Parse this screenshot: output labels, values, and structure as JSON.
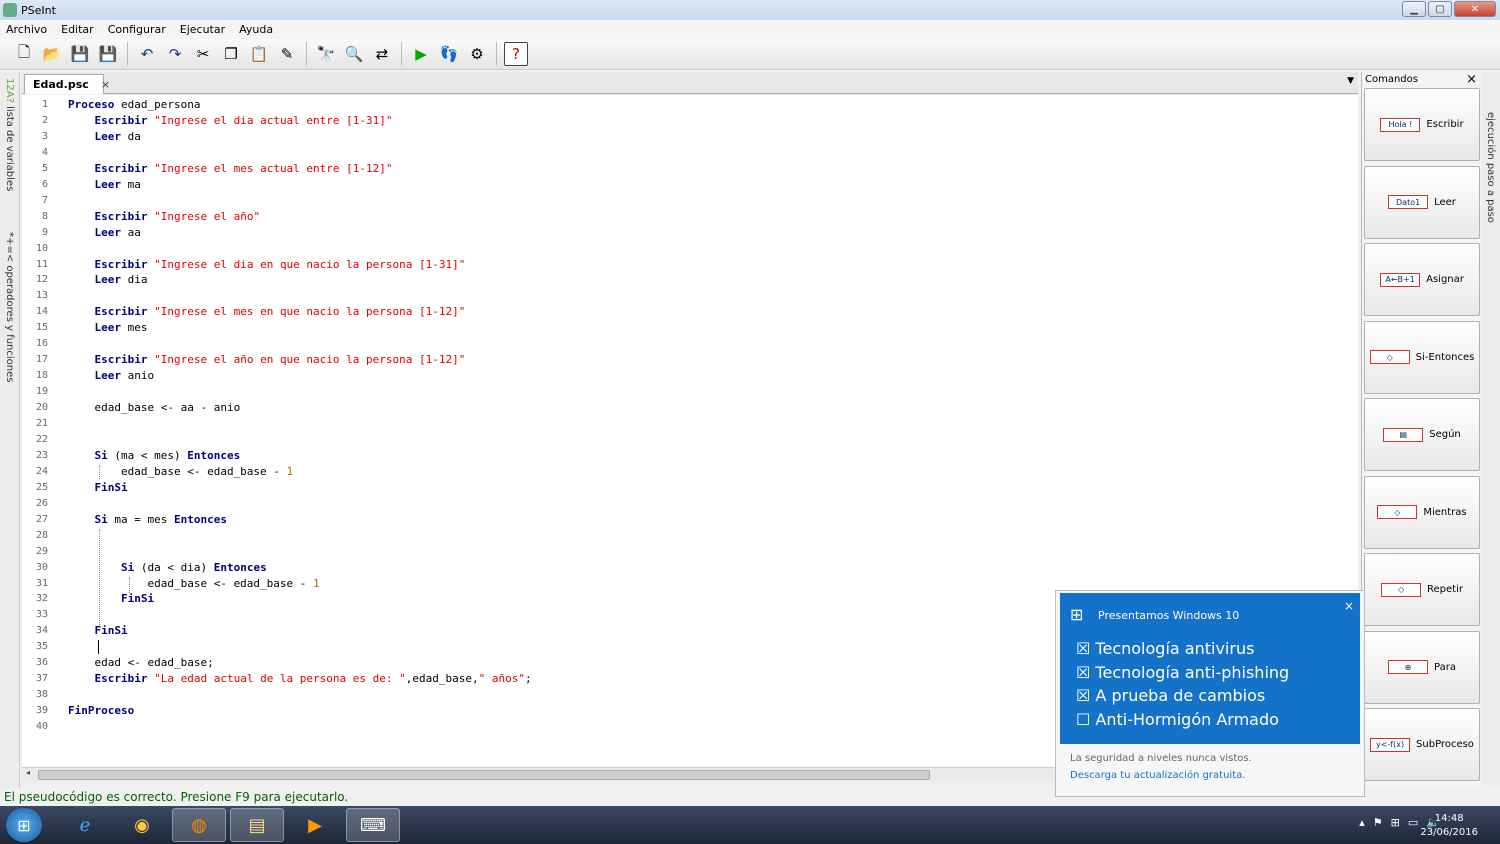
{
  "window": {
    "title": "PSeInt"
  },
  "menu": [
    "Archivo",
    "Editar",
    "Configurar",
    "Ejecutar",
    "Ayuda"
  ],
  "toolbar": {
    "icons": [
      "new-file-icon",
      "open-folder-icon",
      "save-icon",
      "save-as-icon",
      "undo-icon",
      "redo-icon",
      "cut-icon",
      "copy-icon",
      "paste-icon",
      "edit-icon",
      "find-icon",
      "find-next-icon",
      "replace-icon",
      "run-icon",
      "step-icon",
      "debug-icon",
      "help-icon"
    ]
  },
  "left_panel": {
    "vars_label": "lista de variables",
    "ops_label": "operadores y funciones",
    "ops_symbols": "*+=<",
    "vars_symbols": "12A?"
  },
  "tab": {
    "name": "Edad.psc",
    "close": "×"
  },
  "editor": {
    "lines": [
      "Proceso edad_persona",
      "    Escribir \"Ingrese el dia actual entre [1-31]\"",
      "    Leer da",
      "",
      "    Escribir \"Ingrese el mes actual entre [1-12]\"",
      "    Leer ma",
      "",
      "    Escribir \"Ingrese el año\"",
      "    Leer aa",
      "",
      "    Escribir \"Ingrese el dia en que nacio la persona [1-31]\"",
      "    Leer dia",
      "",
      "    Escribir \"Ingrese el mes en que nacio la persona [1-12]\"",
      "    Leer mes",
      "",
      "    Escribir \"Ingrese el año en que nacio la persona [1-12]\"",
      "    Leer anio",
      "",
      "    edad_base <- aa - anio",
      "",
      "",
      "    Si (ma < mes) Entonces",
      "        edad_base <- edad_base - 1",
      "    FinSi",
      "",
      "    Si ma = mes Entonces",
      "",
      "",
      "        Si (da < dia) Entonces",
      "            edad_base <- edad_base - 1",
      "        FinSi",
      "",
      "    FinSi",
      "",
      "    edad <- edad_base;",
      "    Escribir \"La edad actual de la persona es de: \",edad_base,\" años\";",
      "",
      "FinProceso",
      ""
    ]
  },
  "status": "El pseudocódigo es correcto. Presione F9 para ejecutarlo.",
  "commands": {
    "header": "Comandos",
    "close": "×",
    "items": [
      {
        "label": "Escribir",
        "icon_text": "Hola !"
      },
      {
        "label": "Leer",
        "icon_text": "Dato1"
      },
      {
        "label": "Asignar",
        "icon_text": "A←B+1"
      },
      {
        "label": "Si-Entonces",
        "icon_text": "◇"
      },
      {
        "label": "Según",
        "icon_text": "▤"
      },
      {
        "label": "Mientras",
        "icon_text": "◇"
      },
      {
        "label": "Repetir",
        "icon_text": "◇"
      },
      {
        "label": "Para",
        "icon_text": "⊕"
      },
      {
        "label": "SubProceso",
        "icon_text": "y<-f(x)"
      }
    ]
  },
  "right_panel": {
    "label": "ejecución paso a paso"
  },
  "toast": {
    "header": "Presentamos Windows 10",
    "close": "×",
    "items": [
      "☒ Tecnología antivirus",
      "☒ Tecnología anti-phishing",
      "☒ A prueba de cambios",
      "☐ Anti-Hormigón Armado"
    ],
    "footer_text": "La seguridad a niveles nunca vistos.",
    "footer_link": "Descarga tu actualización gratuita."
  },
  "taskbar": {
    "apps": [
      "ie-icon",
      "chrome-icon",
      "firefox-icon",
      "explorer-icon",
      "media-player-icon",
      "pseint-icon"
    ],
    "time": "14:48",
    "date": "23/06/2016"
  }
}
